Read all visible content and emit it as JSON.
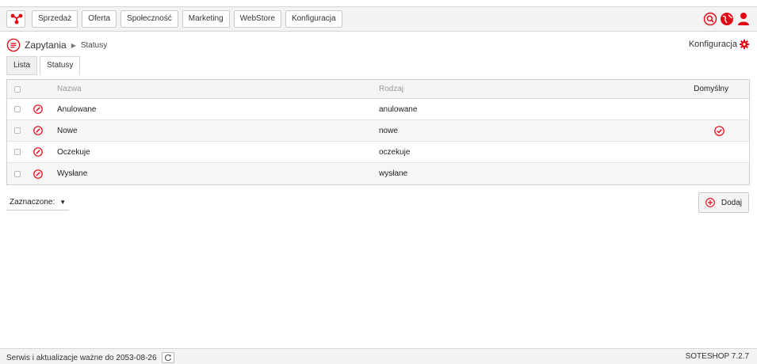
{
  "colors": {
    "accent": "#e30613",
    "border": "#c9c9c9",
    "header_bg": "#f3f3f3"
  },
  "topbar": {
    "logo_icon": "soteshop-logo-icon",
    "menu": [
      "Sprzedaż",
      "Oferta",
      "Społeczność",
      "Marketing",
      "WebStore",
      "Konfiguracja"
    ],
    "icons": [
      "search-icon",
      "globe-icon",
      "user-icon"
    ]
  },
  "breadcrumb": {
    "icon": "chat-icon",
    "title": "Zapytania",
    "current": "Statusy"
  },
  "config_link": {
    "label": "Konfiguracja",
    "icon": "gear-icon"
  },
  "tabs": [
    {
      "label": "Lista",
      "active": false
    },
    {
      "label": "Statusy",
      "active": true
    }
  ],
  "table": {
    "columns": {
      "name": "Nazwa",
      "type": "Rodzaj",
      "default": "Domyślny"
    },
    "rows": [
      {
        "name": "Anulowane",
        "type": "anulowane",
        "default": false
      },
      {
        "name": "Nowe",
        "type": "nowe",
        "default": true
      },
      {
        "name": "Oczekuje",
        "type": "oczekuje",
        "default": false
      },
      {
        "name": "Wysłane",
        "type": "wysłane",
        "default": false
      }
    ]
  },
  "bulk_action": {
    "label": "Zaznaczone:"
  },
  "add_button": {
    "label": "Dodaj",
    "icon": "plus-circle-icon"
  },
  "footer": {
    "license": "Serwis i aktualizacje ważne do 2053-08-26",
    "version": "SOTESHOP 7.2.7",
    "refresh_icon": "refresh-icon"
  }
}
